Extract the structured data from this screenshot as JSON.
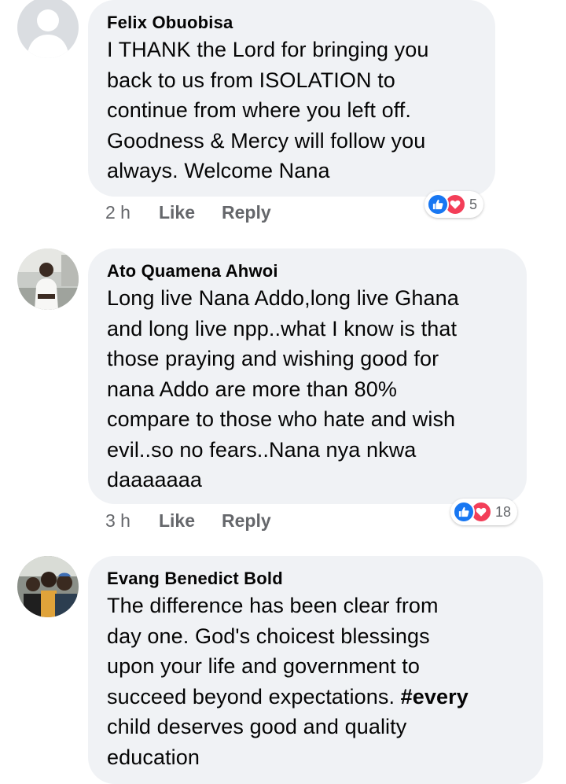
{
  "comments": [
    {
      "author": "Felix Obuobisa",
      "text": "I THANK the Lord for bringing you\nback to us from ISOLATION to\ncontinue from where you left off.\nGoodness & Mercy will follow you\nalways. Welcome Nana",
      "time": "2 h",
      "like_label": "Like",
      "reply_label": "Reply",
      "reaction_count": "5",
      "avatar": "default-profile-silhouette"
    },
    {
      "author": "Ato Quamena Ahwoi",
      "text": "Long live Nana Addo,long live Ghana\nand long live npp..what I know is that\nthose praying and wishing good for\nnana Addo are more than 80%\ncompare to those who hate and wish\nevil..so no fears..Nana nya nkwa\ndaaaaaaa",
      "time": "3 h",
      "like_label": "Like",
      "reply_label": "Reply",
      "reaction_count": "18",
      "avatar": "profile-photo-man-white-shirt"
    },
    {
      "author": "Evang Benedict Bold",
      "text_before": "The difference has been clear from\nday one.  God's choicest blessings\nupon your life and government to\nsucceed beyond expectations. ",
      "hashtag": "#every",
      "text_after": "\nchild deserves good and quality\neducation",
      "avatar": "profile-photo-group-selfie"
    }
  ],
  "colors": {
    "bubble": "#f0f2f5",
    "meta_text": "#65676b",
    "like_blue": "#1877f2",
    "love_red": "#f33e58"
  }
}
